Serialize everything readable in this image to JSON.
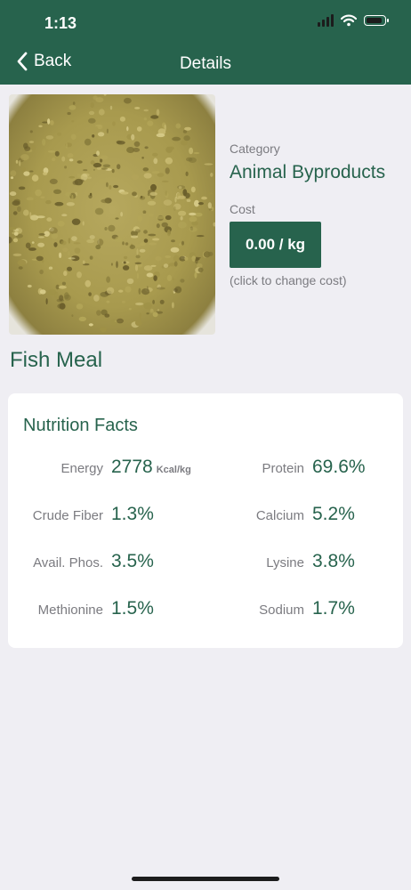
{
  "status_bar": {
    "time": "1:13"
  },
  "nav": {
    "back_label": "Back",
    "title": "Details"
  },
  "item": {
    "name": "Fish Meal",
    "image": "fish-meal-photo",
    "category_caption": "Category",
    "category": "Animal Byproducts",
    "cost_caption": "Cost",
    "cost": "0.00 / kg",
    "cost_hint": "(click to change cost)"
  },
  "nutrition": {
    "title": "Nutrition Facts",
    "facts": [
      {
        "label": "Energy",
        "value": "2778",
        "unit": "Kcal/kg"
      },
      {
        "label": "Protein",
        "value": "69.6%"
      },
      {
        "label": "Crude Fiber",
        "value": "1.3%"
      },
      {
        "label": "Calcium",
        "value": "5.2%"
      },
      {
        "label": "Avail. Phos.",
        "value": "3.5%"
      },
      {
        "label": "Lysine",
        "value": "3.8%"
      },
      {
        "label": "Methionine",
        "value": "1.5%"
      },
      {
        "label": "Sodium",
        "value": "1.7%"
      }
    ]
  },
  "colors": {
    "brand": "#27634d",
    "caption": "#7b7b80",
    "background": "#efeef3"
  }
}
